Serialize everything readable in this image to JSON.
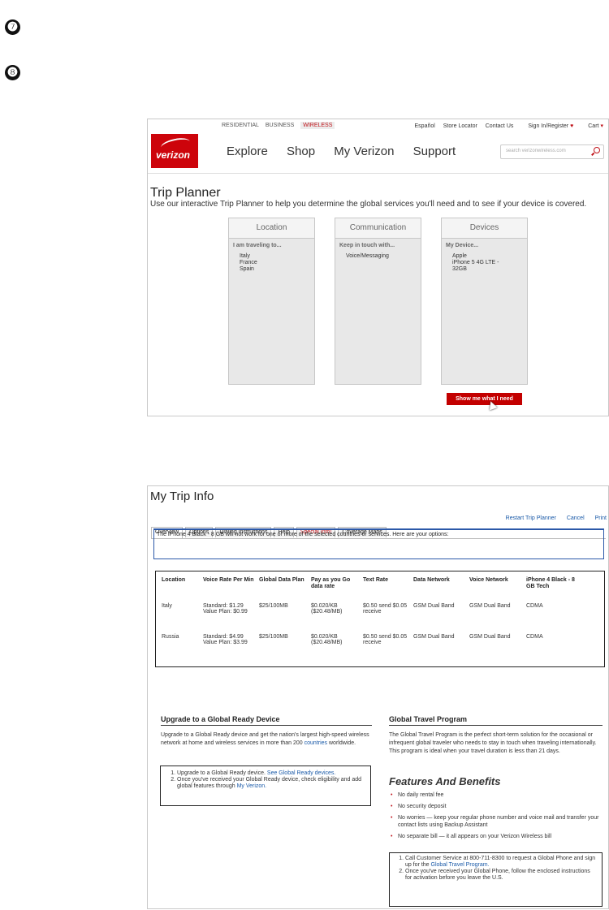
{
  "steps": [
    "❼",
    "❽"
  ],
  "trip_planner": {
    "top_nav": [
      "RESIDENTIAL",
      "BUSINESS",
      "WIRELESS"
    ],
    "util_nav": [
      "Español",
      "Store Locator",
      "Contact Us",
      "Sign In/Register",
      "Cart"
    ],
    "logo_text": "verizon",
    "main_nav": [
      "Explore",
      "Shop",
      "My Verizon",
      "Support"
    ],
    "search_placeholder": "search verizonwireless.com",
    "title": "Trip Planner",
    "description": "Use our interactive Trip Planner to help you determine the global services you'll need and to see if your device is covered.",
    "columns": [
      {
        "header": "Location",
        "sub": "I am traveling to...",
        "values": [
          "Italy",
          "France",
          "Spain"
        ]
      },
      {
        "header": "Communication",
        "sub": "Keep in touch with...",
        "values": [
          "Voice/Messaging"
        ]
      },
      {
        "header": "Devices",
        "sub": "My Device...",
        "values": [
          "Apple",
          "iPhone 5 4G LTE -",
          "32GB"
        ]
      }
    ],
    "button_label": "Show me what I need"
  },
  "trip_info": {
    "title": "My Trip Info",
    "links": [
      "Restart Trip Planner",
      "Cancel",
      "Print"
    ],
    "tabs": [
      "Overview",
      "Options",
      "Dialing Instructions",
      "Help",
      "Special Info!",
      "Coverage Maps"
    ],
    "notice": "The iPhone 4 Black - 8 GB will not work for one or more of the selected countries or services. Here are your options:",
    "table": {
      "headers": [
        "Location",
        "Voice Rate Per Min",
        "Global Data Plan",
        "Pay as you Go data rate",
        "Text Rate",
        "Data Network",
        "Voice Network",
        "iPhone 4 Black - 8 GB Tech"
      ],
      "rows": [
        [
          "Italy",
          "Standard: $1.29 Value Plan: $0.99",
          "$25/100MB",
          "$0.020/KB ($20.48/MB)",
          "$0.50 send $0.05 receive",
          "GSM Dual Band",
          "GSM Dual Band",
          "CDMA"
        ],
        [
          "Russia",
          "Standard: $4.99 Value Plan: $3.99",
          "$25/100MB",
          "$0.020/KB ($20.48/MB)",
          "$0.50 send $0.05 receive",
          "GSM Dual Band",
          "GSM Dual Band",
          "CDMA"
        ]
      ]
    },
    "upgrade": {
      "title": "Upgrade to a Global Ready Device",
      "text_before": "Upgrade to a Global Ready device and get the nation's largest high-speed wireless network at home and wireless services in more than 200 ",
      "text_link": "countries",
      "text_after": " worldwide.",
      "step1": "Upgrade to a Global Ready device. ",
      "step1_link": "See Global Ready devices.",
      "step2": "Once you've received your Global Ready device, check eligibility and add global features through ",
      "step2_link": "My Verizon."
    },
    "gtp": {
      "title": "Global Travel Program",
      "text": "The Global Travel Program is the perfect short-term solution for the occasional or infrequent global traveler who needs to stay in touch when traveling internationally. This program is ideal when your travel duration is less than 21 days.",
      "features_title": "Features And Benefits",
      "features": [
        "No daily rental fee",
        "No security deposit",
        "No worries — keep your regular phone number and voice mail and transfer your contact lists using Backup Assistant",
        "No separate bill — it all appears on your Verizon Wireless bill"
      ],
      "step1": "Call Customer Service at 800-711-8300 to request a Global Phone and sign up for the ",
      "step1_link": "Global Travel Program.",
      "step2": "Once you've received your Global Phone, follow the enclosed instructions for activation before you leave the U.S."
    }
  }
}
